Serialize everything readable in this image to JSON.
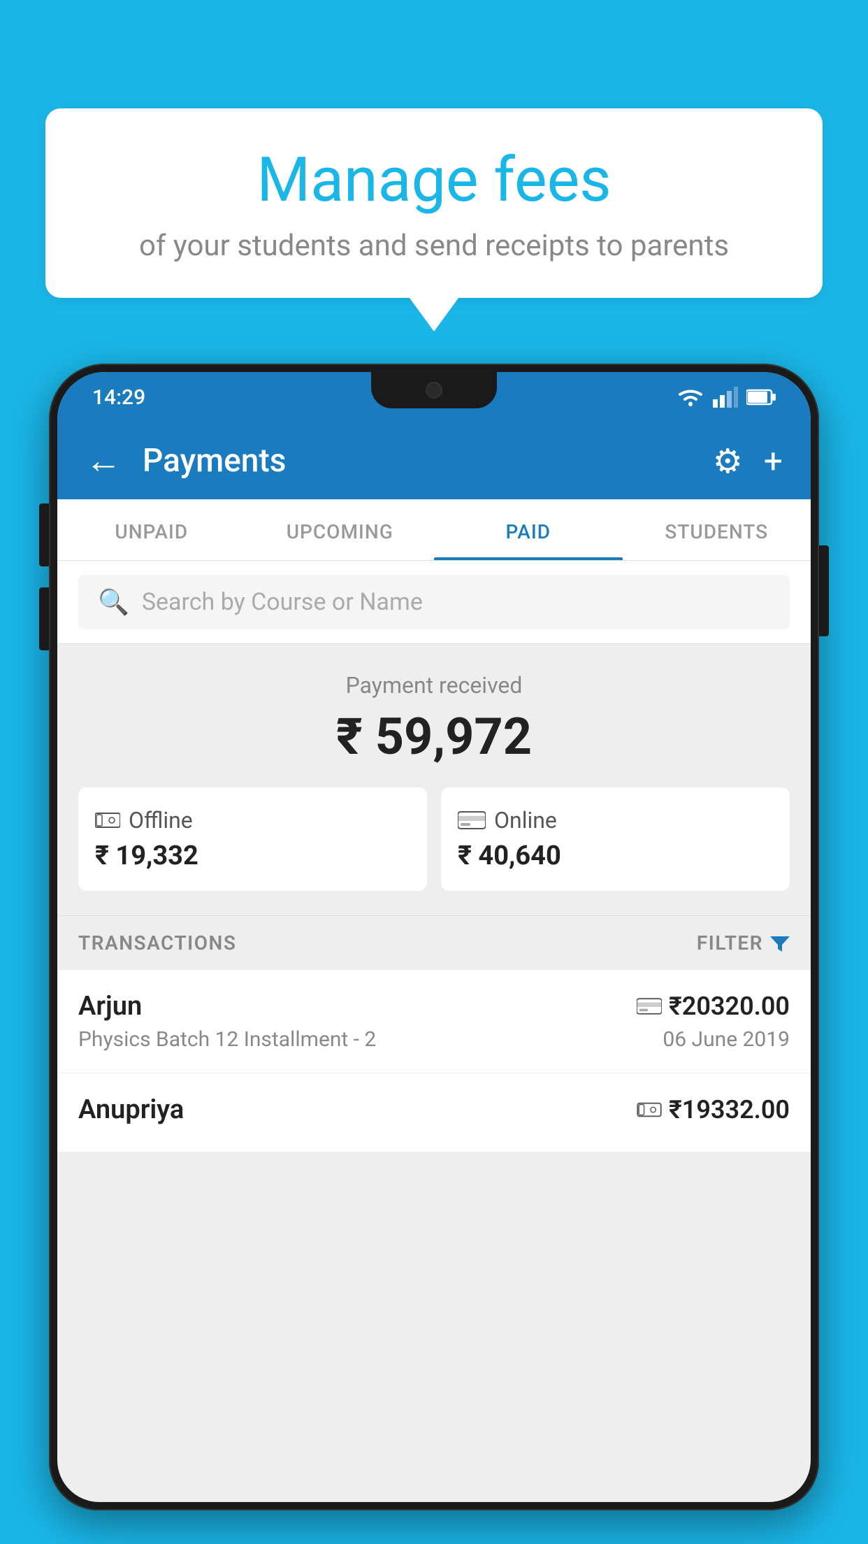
{
  "background_color": "#1ab6e8",
  "bubble": {
    "title": "Manage fees",
    "subtitle": "of your students and send receipts to parents"
  },
  "status_bar": {
    "time": "14:29"
  },
  "app_bar": {
    "title": "Payments",
    "back_label": "←",
    "settings_label": "⚙",
    "add_label": "+"
  },
  "tabs": [
    {
      "label": "UNPAID",
      "active": false
    },
    {
      "label": "UPCOMING",
      "active": false
    },
    {
      "label": "PAID",
      "active": true
    },
    {
      "label": "STUDENTS",
      "active": false
    }
  ],
  "search": {
    "placeholder": "Search by Course or Name"
  },
  "payment_summary": {
    "received_label": "Payment received",
    "total_amount": "₹ 59,972",
    "offline": {
      "label": "Offline",
      "amount": "₹ 19,332"
    },
    "online": {
      "label": "Online",
      "amount": "₹ 40,640"
    }
  },
  "transactions": {
    "header_label": "TRANSACTIONS",
    "filter_label": "FILTER",
    "items": [
      {
        "name": "Arjun",
        "course": "Physics Batch 12 Installment - 2",
        "amount": "₹20320.00",
        "date": "06 June 2019",
        "icon": "card"
      },
      {
        "name": "Anupriya",
        "course": "",
        "amount": "₹19332.00",
        "date": "",
        "icon": "cash"
      }
    ]
  }
}
